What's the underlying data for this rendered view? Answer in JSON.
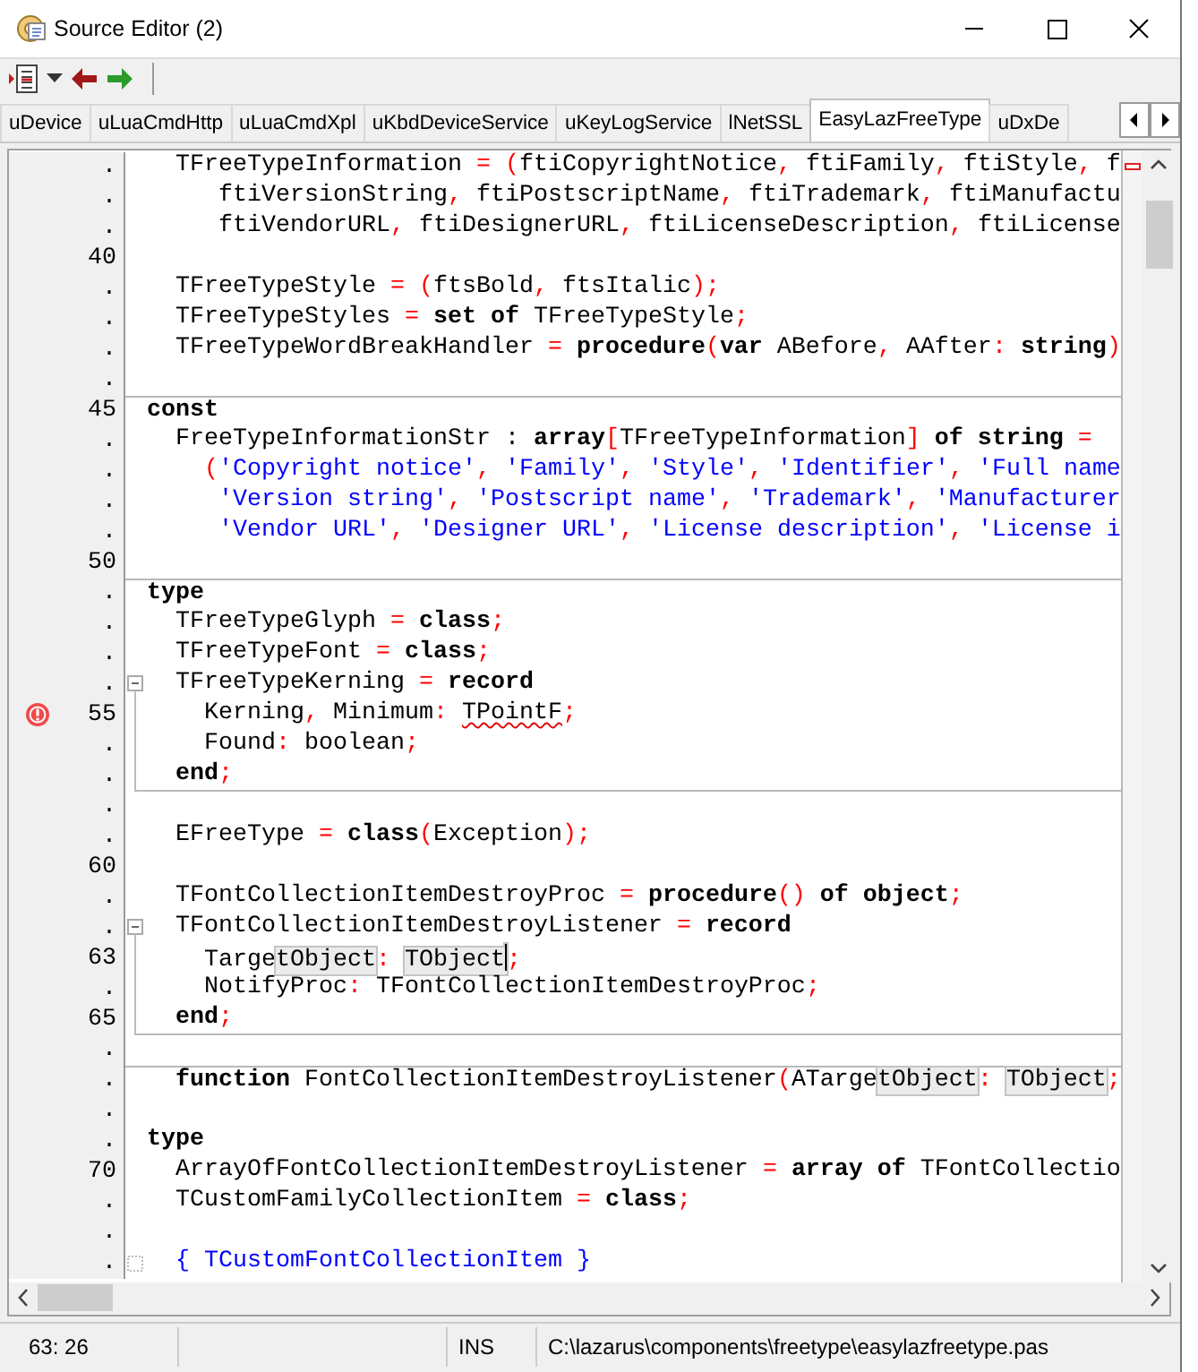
{
  "window": {
    "title": "Source Editor (2)"
  },
  "tabs": [
    {
      "label": "uDevice",
      "selected": false
    },
    {
      "label": "uLuaCmdHttp",
      "selected": false
    },
    {
      "label": "uLuaCmdXpl",
      "selected": false
    },
    {
      "label": "uKbdDeviceService",
      "selected": false
    },
    {
      "label": "uKeyLogService",
      "selected": false
    },
    {
      "label": "lNetSSL",
      "selected": false
    },
    {
      "label": "EasyLazFreeType",
      "selected": true
    },
    {
      "label": "uDxDe",
      "selected": false
    }
  ],
  "editor": {
    "lines": [
      {
        "number": ".",
        "kind": "code",
        "segments": [
          {
            "kind": "text",
            "text": "  TFreeTypeInformation "
          },
          {
            "kind": "symbol",
            "text": "= ("
          },
          {
            "kind": "text",
            "text": "ftiCopyrightNotice"
          },
          {
            "kind": "symbol",
            "text": ", "
          },
          {
            "kind": "text",
            "text": "ftiFamily"
          },
          {
            "kind": "symbol",
            "text": ", "
          },
          {
            "kind": "text",
            "text": "ftiStyle"
          },
          {
            "kind": "symbol",
            "text": ", "
          },
          {
            "kind": "text",
            "text": "f"
          }
        ]
      },
      {
        "number": ".",
        "kind": "code",
        "segments": [
          {
            "kind": "text",
            "text": "     ftiVersionString"
          },
          {
            "kind": "symbol",
            "text": ", "
          },
          {
            "kind": "text",
            "text": "ftiPostscriptName"
          },
          {
            "kind": "symbol",
            "text": ", "
          },
          {
            "kind": "text",
            "text": "ftiTrademark"
          },
          {
            "kind": "symbol",
            "text": ", "
          },
          {
            "kind": "text",
            "text": "ftiManufactu"
          }
        ]
      },
      {
        "number": ".",
        "kind": "code",
        "segments": [
          {
            "kind": "text",
            "text": "     ftiVendorURL"
          },
          {
            "kind": "symbol",
            "text": ", "
          },
          {
            "kind": "text",
            "text": "ftiDesignerURL"
          },
          {
            "kind": "symbol",
            "text": ", "
          },
          {
            "kind": "text",
            "text": "ftiLicenseDescription"
          },
          {
            "kind": "symbol",
            "text": ", "
          },
          {
            "kind": "text",
            "text": "ftiLicense"
          }
        ]
      },
      {
        "number": "40",
        "kind": "code"
      },
      {
        "number": ".",
        "kind": "code",
        "segments": [
          {
            "kind": "text",
            "text": "  TFreeTypeStyle "
          },
          {
            "kind": "symbol",
            "text": "= ("
          },
          {
            "kind": "text",
            "text": "ftsBold"
          },
          {
            "kind": "symbol",
            "text": ", "
          },
          {
            "kind": "text",
            "text": "ftsItalic"
          },
          {
            "kind": "symbol",
            "text": ");"
          }
        ]
      },
      {
        "number": ".",
        "kind": "code",
        "segments": [
          {
            "kind": "text",
            "text": "  TFreeTypeStyles "
          },
          {
            "kind": "symbol",
            "text": "= "
          },
          {
            "kind": "keyword",
            "text": "set of"
          },
          {
            "kind": "text",
            "text": " TFreeTypeStyle"
          },
          {
            "kind": "symbol",
            "text": ";"
          }
        ]
      },
      {
        "number": ".",
        "kind": "code",
        "segments": [
          {
            "kind": "text",
            "text": "  TFreeTypeWordBreakHandler "
          },
          {
            "kind": "symbol",
            "text": "= "
          },
          {
            "kind": "keyword",
            "text": "procedure"
          },
          {
            "kind": "symbol",
            "text": "("
          },
          {
            "kind": "keyword",
            "text": "var"
          },
          {
            "kind": "text",
            "text": " ABefore"
          },
          {
            "kind": "symbol",
            "text": ", "
          },
          {
            "kind": "text",
            "text": "AAfter"
          },
          {
            "kind": "symbol",
            "text": ": "
          },
          {
            "kind": "keyword",
            "text": "string"
          },
          {
            "kind": "symbol",
            "text": ")"
          }
        ]
      },
      {
        "number": ".",
        "kind": "code"
      },
      {
        "number": "45",
        "kind": "code",
        "divider": true,
        "segments": [
          {
            "kind": "keyword",
            "text": "const"
          }
        ]
      },
      {
        "number": ".",
        "kind": "code",
        "segments": [
          {
            "kind": "text",
            "text": "  FreeTypeInformationStr : "
          },
          {
            "kind": "keyword",
            "text": "array"
          },
          {
            "kind": "symbol",
            "text": "["
          },
          {
            "kind": "text",
            "text": "TFreeTypeInformation"
          },
          {
            "kind": "symbol",
            "text": "]"
          },
          {
            "kind": "keyword",
            "text": " of string"
          },
          {
            "kind": "symbol",
            "text": " ="
          }
        ]
      },
      {
        "number": ".",
        "kind": "code",
        "segments": [
          {
            "kind": "symbol",
            "text": "    ("
          },
          {
            "kind": "string",
            "text": "'Copyright notice'"
          },
          {
            "kind": "symbol",
            "text": ", "
          },
          {
            "kind": "string",
            "text": "'Family'"
          },
          {
            "kind": "symbol",
            "text": ", "
          },
          {
            "kind": "string",
            "text": "'Style'"
          },
          {
            "kind": "symbol",
            "text": ", "
          },
          {
            "kind": "string",
            "text": "'Identifier'"
          },
          {
            "kind": "symbol",
            "text": ", "
          },
          {
            "kind": "string",
            "text": "'Full name"
          }
        ]
      },
      {
        "number": ".",
        "kind": "code",
        "segments": [
          {
            "kind": "string",
            "text": "     'Version string'"
          },
          {
            "kind": "symbol",
            "text": ", "
          },
          {
            "kind": "string",
            "text": "'Postscript name'"
          },
          {
            "kind": "symbol",
            "text": ", "
          },
          {
            "kind": "string",
            "text": "'Trademark'"
          },
          {
            "kind": "symbol",
            "text": ", "
          },
          {
            "kind": "string",
            "text": "'Manufacturer"
          }
        ]
      },
      {
        "number": ".",
        "kind": "code",
        "segments": [
          {
            "kind": "string",
            "text": "     'Vendor URL'"
          },
          {
            "kind": "symbol",
            "text": ", "
          },
          {
            "kind": "string",
            "text": "'Designer URL'"
          },
          {
            "kind": "symbol",
            "text": ", "
          },
          {
            "kind": "string",
            "text": "'License description'"
          },
          {
            "kind": "symbol",
            "text": ", "
          },
          {
            "kind": "string",
            "text": "'License i"
          }
        ]
      },
      {
        "number": "50",
        "kind": "code"
      },
      {
        "number": ".",
        "kind": "code",
        "divider": true,
        "segments": [
          {
            "kind": "keyword",
            "text": "type"
          }
        ]
      },
      {
        "number": ".",
        "kind": "code",
        "segments": [
          {
            "kind": "text",
            "text": "  TFreeTypeGlyph "
          },
          {
            "kind": "symbol",
            "text": "= "
          },
          {
            "kind": "keyword",
            "text": "class"
          },
          {
            "kind": "symbol",
            "text": ";"
          }
        ]
      },
      {
        "number": ".",
        "kind": "code",
        "segments": [
          {
            "kind": "text",
            "text": "  TFreeTypeFont "
          },
          {
            "kind": "symbol",
            "text": "= "
          },
          {
            "kind": "keyword",
            "text": "class"
          },
          {
            "kind": "symbol",
            "text": ";"
          }
        ]
      },
      {
        "number": ".",
        "kind": "fold_start",
        "segments": [
          {
            "kind": "text",
            "text": "  TFreeTypeKerning "
          },
          {
            "kind": "symbol",
            "text": "= "
          },
          {
            "kind": "keyword",
            "text": "record"
          }
        ]
      },
      {
        "number": "55",
        "kind": "fold_body",
        "error": true,
        "segments": [
          {
            "kind": "text",
            "text": "    Kerning"
          },
          {
            "kind": "symbol",
            "text": ", "
          },
          {
            "kind": "text",
            "text": "Minimum"
          },
          {
            "kind": "symbol",
            "text": ": "
          },
          {
            "kind": "error",
            "text": "TPointF"
          },
          {
            "kind": "symbol",
            "text": ";"
          }
        ]
      },
      {
        "number": ".",
        "kind": "fold_body",
        "segments": [
          {
            "kind": "text",
            "text": "    Found"
          },
          {
            "kind": "symbol",
            "text": ": "
          },
          {
            "kind": "text",
            "text": "boolean"
          },
          {
            "kind": "symbol",
            "text": ";"
          }
        ]
      },
      {
        "number": ".",
        "kind": "fold_end",
        "segments": [
          {
            "kind": "keyword",
            "text": "  end"
          },
          {
            "kind": "symbol",
            "text": ";"
          }
        ]
      },
      {
        "number": ".",
        "kind": "code"
      },
      {
        "number": ".",
        "kind": "code",
        "segments": [
          {
            "kind": "text",
            "text": "  EFreeType "
          },
          {
            "kind": "symbol",
            "text": "= "
          },
          {
            "kind": "keyword",
            "text": "class"
          },
          {
            "kind": "symbol",
            "text": "("
          },
          {
            "kind": "text",
            "text": "Exception"
          },
          {
            "kind": "symbol",
            "text": ");"
          }
        ]
      },
      {
        "number": "60",
        "kind": "code"
      },
      {
        "number": ".",
        "kind": "code",
        "segments": [
          {
            "kind": "text",
            "text": "  TFontCollectionItemDestroyProc "
          },
          {
            "kind": "symbol",
            "text": "= "
          },
          {
            "kind": "keyword",
            "text": "procedure"
          },
          {
            "kind": "symbol",
            "text": "()"
          },
          {
            "kind": "keyword",
            "text": " of object"
          },
          {
            "kind": "symbol",
            "text": ";"
          }
        ]
      },
      {
        "number": ".",
        "kind": "fold_start",
        "segments": [
          {
            "kind": "text",
            "text": "  TFontCollectionItemDestroyListener "
          },
          {
            "kind": "symbol",
            "text": "= "
          },
          {
            "kind": "keyword",
            "text": "record"
          }
        ]
      },
      {
        "number": "63",
        "kind": "fold_body",
        "segments": [
          {
            "kind": "text",
            "text": "    Targe"
          },
          {
            "kind": "highlight",
            "text": "tObject"
          },
          {
            "kind": "symbol",
            "text": ": "
          },
          {
            "kind": "highlight",
            "text": "TObject",
            "caret": true
          },
          {
            "kind": "symbol",
            "text": ";"
          }
        ]
      },
      {
        "number": ".",
        "kind": "fold_body",
        "segments": [
          {
            "kind": "text",
            "text": "    NotifyProc"
          },
          {
            "kind": "symbol",
            "text": ": "
          },
          {
            "kind": "text",
            "text": "TFontCollectionItemDestroyProc"
          },
          {
            "kind": "symbol",
            "text": ";"
          }
        ]
      },
      {
        "number": "65",
        "kind": "fold_end",
        "segments": [
          {
            "kind": "keyword",
            "text": "  end"
          },
          {
            "kind": "symbol",
            "text": ";"
          }
        ]
      },
      {
        "number": ".",
        "kind": "code"
      },
      {
        "number": ".",
        "kind": "code",
        "divider": true,
        "segments": [
          {
            "kind": "keyword",
            "text": "  function"
          },
          {
            "kind": "text",
            "text": " FontCollectionItemDestroyListener"
          },
          {
            "kind": "symbol",
            "text": "("
          },
          {
            "kind": "text",
            "text": "ATarge"
          },
          {
            "kind": "highlight",
            "text": "tObject"
          },
          {
            "kind": "symbol",
            "text": ": "
          },
          {
            "kind": "highlight",
            "text": "TObject"
          },
          {
            "kind": "symbol",
            "text": ";"
          }
        ]
      },
      {
        "number": ".",
        "kind": "code"
      },
      {
        "number": ".",
        "kind": "code",
        "segments": [
          {
            "kind": "keyword",
            "text": "type"
          }
        ]
      },
      {
        "number": "70",
        "kind": "code",
        "segments": [
          {
            "kind": "text",
            "text": "  ArrayOfFontCollectionItemDestroyListener "
          },
          {
            "kind": "symbol",
            "text": "= "
          },
          {
            "kind": "keyword",
            "text": "array of"
          },
          {
            "kind": "text",
            "text": " TFontCollectio"
          }
        ]
      },
      {
        "number": ".",
        "kind": "code",
        "segments": [
          {
            "kind": "text",
            "text": "  TCustomFamilyCollectionItem "
          },
          {
            "kind": "symbol",
            "text": "= "
          },
          {
            "kind": "keyword",
            "text": "class"
          },
          {
            "kind": "symbol",
            "text": ";"
          }
        ]
      },
      {
        "number": ".",
        "kind": "code"
      },
      {
        "number": ".",
        "kind": "fold_mark",
        "segments": [
          {
            "kind": "comment",
            "text": "  { TCustomFontCollectionItem }"
          }
        ]
      }
    ]
  },
  "status_bar": {
    "position": "63: 26",
    "mode": "INS",
    "file": "C:\\lazarus\\components\\freetype\\easylazfreetype.pas"
  }
}
